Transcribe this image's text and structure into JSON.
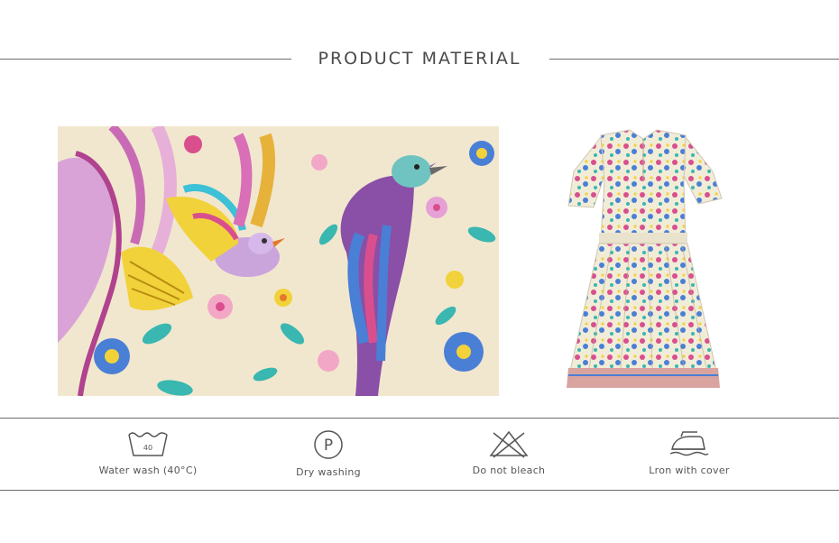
{
  "header": {
    "title": "PRODUCT MATERIAL"
  },
  "images": {
    "fabric_closeup": "floral-bird-print-fabric",
    "dress": "floral-print-short-sleeve-dress"
  },
  "care": {
    "items": [
      {
        "icon": "wash-40-icon",
        "label": "Water wash (40°C)",
        "temp": "40"
      },
      {
        "icon": "dry-clean-p-icon",
        "label": "Dry washing",
        "symbol": "P"
      },
      {
        "icon": "no-bleach-icon",
        "label": "Do not bleach"
      },
      {
        "icon": "iron-icon",
        "label": "Lron with cover"
      }
    ]
  },
  "colors": {
    "line": "#6d6d6d",
    "text": "#555555",
    "fabric_base": "#f1e7cf",
    "pink": "#d94f8e",
    "blue": "#4a7fd6",
    "teal": "#39b7b0",
    "yellow": "#f2d23a",
    "purple": "#8a4fa6"
  }
}
